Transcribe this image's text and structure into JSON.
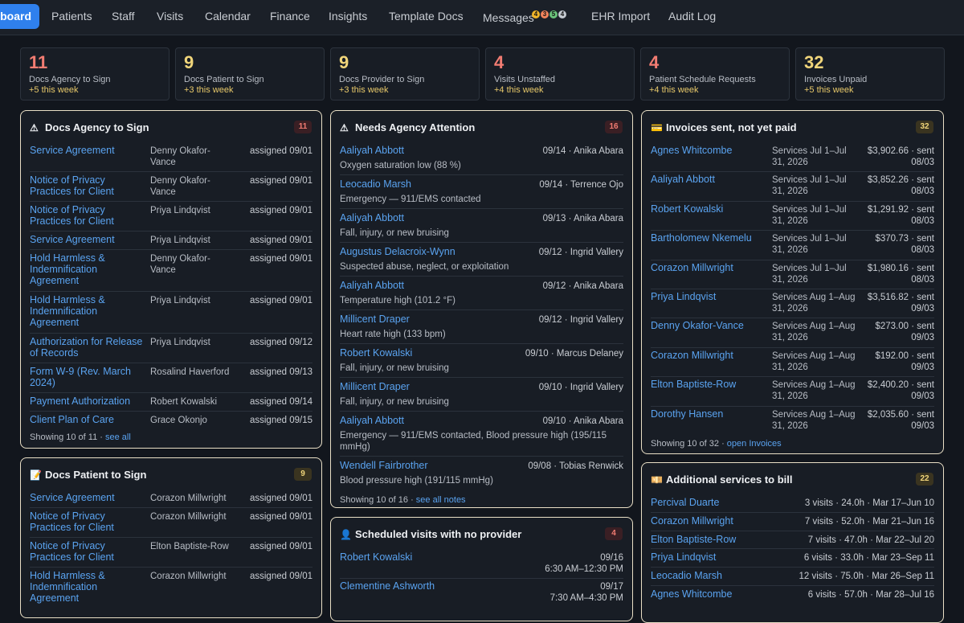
{
  "nav": {
    "active": "board",
    "items": [
      "Patients",
      "Staff",
      "Visits",
      "Calendar",
      "Finance",
      "Insights",
      "Template Docs",
      "Messages",
      "EHR Import",
      "Audit Log"
    ],
    "message_badges": [
      {
        "value": "4",
        "color": "#f0b429"
      },
      {
        "value": "3",
        "color": "#f2845c"
      },
      {
        "value": "5",
        "color": "#6ac27a"
      },
      {
        "value": "4",
        "color": "#c5cad1"
      }
    ]
  },
  "stats": [
    {
      "value": "11",
      "label": "Docs Agency to Sign",
      "delta": "+5 this week",
      "color": "#f27c72"
    },
    {
      "value": "9",
      "label": "Docs Patient to Sign",
      "delta": "+3 this week",
      "color": "#f0d57a"
    },
    {
      "value": "9",
      "label": "Docs Provider to Sign",
      "delta": "+3 this week",
      "color": "#f0d57a"
    },
    {
      "value": "4",
      "label": "Visits Unstaffed",
      "delta": "+4 this week",
      "color": "#f27c72"
    },
    {
      "value": "4",
      "label": "Patient Schedule Requests",
      "delta": "+4 this week",
      "color": "#f27c72"
    },
    {
      "value": "32",
      "label": "Invoices Unpaid",
      "delta": "+5 this week",
      "color": "#f0d57a"
    }
  ],
  "agency": {
    "icon": "⚠",
    "title": "Docs Agency to Sign",
    "count": "11",
    "rows": [
      {
        "doc": [
          "Service Agreement"
        ],
        "who": [
          "Denny Okafor-",
          "Vance"
        ],
        "when": "assigned 09/01"
      },
      {
        "doc": [
          "Notice of Privacy",
          "Practices for Client"
        ],
        "who": [
          "Denny Okafor-",
          "Vance"
        ],
        "when": "assigned 09/01"
      },
      {
        "doc": [
          "Notice of Privacy",
          "Practices for Client"
        ],
        "who": [
          "Priya Lindqvist"
        ],
        "when": "assigned 09/01"
      },
      {
        "doc": [
          "Service Agreement"
        ],
        "who": [
          "Priya Lindqvist"
        ],
        "when": "assigned 09/01"
      },
      {
        "doc": [
          "Hold Harmless &",
          "Indemnification",
          "Agreement"
        ],
        "who": [
          "Denny Okafor-",
          "Vance"
        ],
        "when": "assigned 09/01"
      },
      {
        "doc": [
          "Hold Harmless &",
          "Indemnification",
          "Agreement"
        ],
        "who": [
          "Priya Lindqvist"
        ],
        "when": "assigned 09/01"
      },
      {
        "doc": [
          "Authorization for Release",
          "of Records"
        ],
        "who": [
          "Priya Lindqvist"
        ],
        "when": "assigned 09/12"
      },
      {
        "doc": [
          "Form W-9 (Rev. March",
          "2024)"
        ],
        "who": [
          "Rosalind Haverford"
        ],
        "when": "assigned 09/13"
      },
      {
        "doc": [
          "Payment Authorization"
        ],
        "who": [
          "Robert Kowalski"
        ],
        "when": "assigned 09/14"
      },
      {
        "doc": [
          "Client Plan of Care"
        ],
        "who": [
          "Grace Okonjo"
        ],
        "when": "assigned 09/15"
      }
    ],
    "footer": "Showing 10 of 11 ·",
    "footer_link": "see all"
  },
  "patient_docs": {
    "icon": "📝",
    "title": "Docs Patient to Sign",
    "count": "9",
    "rows": [
      {
        "doc": [
          "Service Agreement"
        ],
        "who": [
          "Corazon Millwright"
        ],
        "when": "assigned 09/01"
      },
      {
        "doc": [
          "Notice of Privacy",
          "Practices for Client"
        ],
        "who": [
          "Corazon Millwright"
        ],
        "when": "assigned 09/01"
      },
      {
        "doc": [
          "Notice of Privacy",
          "Practices for Client"
        ],
        "who": [
          "Elton Baptiste-Row"
        ],
        "when": "assigned 09/01"
      },
      {
        "doc": [
          "Hold Harmless &",
          "Indemnification",
          "Agreement"
        ],
        "who": [
          "Corazon Millwright"
        ],
        "when": "assigned 09/01"
      }
    ]
  },
  "attention": {
    "icon": "⚠",
    "title": "Needs Agency Attention",
    "count": "16",
    "rows": [
      {
        "name": "Aaliyah Abbott",
        "meta": "09/14 · Anika Abara",
        "note": [
          "Oxygen saturation low (88 %)"
        ]
      },
      {
        "name": "Leocadio Marsh",
        "meta": "09/14 · Terrence Ojo",
        "note": [
          "Emergency — 911/EMS contacted"
        ]
      },
      {
        "name": "Aaliyah Abbott",
        "meta": "09/13 · Anika Abara",
        "note": [
          "Fall, injury, or new bruising"
        ]
      },
      {
        "name": "Augustus Delacroix-Wynn",
        "meta": "09/12 · Ingrid Vallery",
        "note": [
          "Suspected abuse, neglect, or exploitation"
        ]
      },
      {
        "name": "Aaliyah Abbott",
        "meta": "09/12 · Anika Abara",
        "note": [
          "Temperature high (101.2 °F)"
        ]
      },
      {
        "name": "Millicent Draper",
        "meta": "09/12 · Ingrid Vallery",
        "note": [
          "Heart rate high (133 bpm)"
        ]
      },
      {
        "name": "Robert Kowalski",
        "meta": "09/10 · Marcus Delaney",
        "note": [
          "Fall, injury, or new bruising"
        ]
      },
      {
        "name": "Millicent Draper",
        "meta": "09/10 · Ingrid Vallery",
        "note": [
          "Fall, injury, or new bruising"
        ]
      },
      {
        "name": "Aaliyah Abbott",
        "meta": "09/10 · Anika Abara",
        "note": [
          "Emergency — 911/EMS contacted, Blood pressure high (195/115",
          "mmHg)"
        ]
      },
      {
        "name": "Wendell Fairbrother",
        "meta": "09/08 · Tobias Renwick",
        "note": [
          "Blood pressure high (191/115 mmHg)"
        ]
      }
    ],
    "footer": "Showing 10 of 16 ·",
    "footer_link": "see all notes"
  },
  "scheduled": {
    "icon": "👤",
    "title": "Scheduled visits with no provider",
    "count": "4",
    "rows": [
      {
        "name": "Robert Kowalski",
        "date": "09/16",
        "time": "6:30 AM–12:30 PM"
      },
      {
        "name": "Clementine Ashworth",
        "date": "09/17",
        "time": "7:30 AM–4:30 PM"
      }
    ]
  },
  "invoices": {
    "icon": "💳",
    "title": "Invoices sent, not yet paid",
    "count": "32",
    "rows": [
      {
        "name": "Agnes Whitcombe",
        "svc": [
          "Services Jul 1–Jul",
          "31, 2026"
        ],
        "amt": [
          "$3,902.66 · sent",
          "08/03"
        ]
      },
      {
        "name": "Aaliyah Abbott",
        "svc": [
          "Services Jul 1–Jul",
          "31, 2026"
        ],
        "amt": [
          "$3,852.26 · sent",
          "08/03"
        ]
      },
      {
        "name": "Robert Kowalski",
        "svc": [
          "Services Jul 1–Jul",
          "31, 2026"
        ],
        "amt": [
          "$1,291.92 · sent",
          "08/03"
        ]
      },
      {
        "name": "Bartholomew Nkemelu",
        "svc": [
          "Services Jul 1–Jul",
          "31, 2026"
        ],
        "amt": [
          "$370.73 · sent",
          "08/03"
        ]
      },
      {
        "name": "Corazon Millwright",
        "svc": [
          "Services Jul 1–Jul",
          "31, 2026"
        ],
        "amt": [
          "$1,980.16 · sent",
          "08/03"
        ]
      },
      {
        "name": "Priya Lindqvist",
        "svc": [
          "Services Aug 1–Aug",
          "31, 2026"
        ],
        "amt": [
          "$3,516.82 · sent",
          "09/03"
        ]
      },
      {
        "name": "Denny Okafor-Vance",
        "svc": [
          "Services Aug 1–Aug",
          "31, 2026"
        ],
        "amt": [
          "$273.00 · sent",
          "09/03"
        ]
      },
      {
        "name": "Corazon Millwright",
        "svc": [
          "Services Aug 1–Aug",
          "31, 2026"
        ],
        "amt": [
          "$192.00 · sent",
          "09/03"
        ]
      },
      {
        "name": "Elton Baptiste-Row",
        "svc": [
          "Services Aug 1–Aug",
          "31, 2026"
        ],
        "amt": [
          "$2,400.20 · sent",
          "09/03"
        ]
      },
      {
        "name": "Dorothy Hansen",
        "svc": [
          "Services Aug 1–Aug",
          "31, 2026"
        ],
        "amt": [
          "$2,035.60 · sent",
          "09/03"
        ]
      }
    ],
    "footer": "Showing 10 of 32 ·",
    "footer_link": "open Invoices"
  },
  "services": {
    "icon": "💴",
    "title": "Additional services to bill",
    "count": "22",
    "rows": [
      {
        "name": "Percival Duarte",
        "detail": "3 visits · 24.0h · Mar 17–Jun 10"
      },
      {
        "name": "Corazon Millwright",
        "detail": "7 visits · 52.0h · Mar 21–Jun 16"
      },
      {
        "name": "Elton Baptiste-Row",
        "detail": "7 visits · 47.0h · Mar 22–Jul 20"
      },
      {
        "name": "Priya Lindqvist",
        "detail": "6 visits · 33.0h · Mar 23–Sep 11"
      },
      {
        "name": "Leocadio Marsh",
        "detail": "12 visits · 75.0h · Mar 26–Sep 11"
      },
      {
        "name": "Agnes Whitcombe",
        "detail": "6 visits · 57.0h · Mar 28–Jul 16"
      }
    ]
  }
}
